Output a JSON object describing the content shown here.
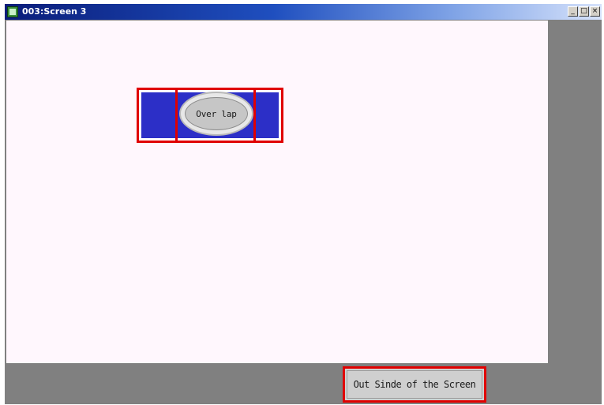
{
  "window": {
    "title": "003:Screen 3",
    "buttons": {
      "minimize": "_",
      "maximize": "□",
      "close": "×"
    }
  },
  "screen": {
    "overlap_label": "Over lap",
    "outside_label": "Out Sinde of the Screen"
  },
  "colors": {
    "title_bar": "#0a1d7a",
    "screen_bg": "#fff7fd",
    "outside_bg": "#808080",
    "highlight_border": "#e00000",
    "blue_panel": "#2c2fc7",
    "button_gray": "#c6c6c6"
  },
  "icons": {
    "app_icon": "screen-app-icon"
  }
}
